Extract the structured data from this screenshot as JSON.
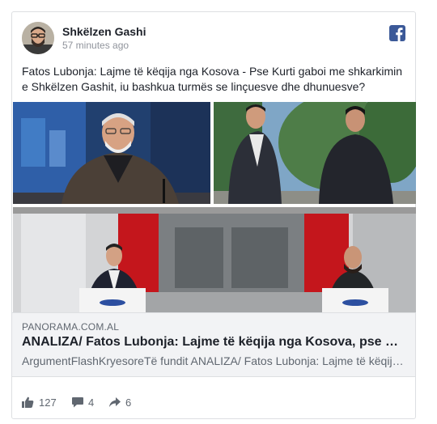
{
  "post": {
    "author": "Shkëlzen Gashi",
    "time": "57 minutes ago",
    "text": "Fatos Lubonja: Lajme të këqija nga Kosova - Pse Kurti gaboi me shkarkimin e Shkëlzen Gashit, iu bashkua turmës se linçuesve dhe dhunuesve?"
  },
  "link": {
    "domain": "PANORAMA.COM.AL",
    "title": "ANALIZA/ Fatos Lubonja: Lajme të këqija nga Kosova, pse Kurti gaboi me shkarkimin e Shkëlzen Gashit",
    "description": "ArgumentFlashKryesoreTë fundit ANALIZA/ Fatos Lubonja: Lajme të këqija nga Kosova"
  },
  "stats": {
    "likes": "127",
    "comments": "4",
    "shares": "6"
  },
  "colors": {
    "facebook_blue": "#3b5998",
    "muted_text": "#606770",
    "link_bg": "#f2f3f5"
  }
}
